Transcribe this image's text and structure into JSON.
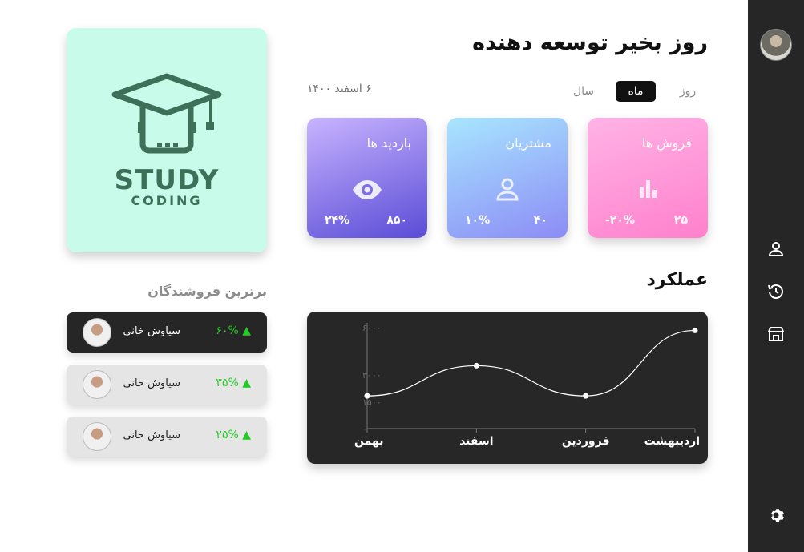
{
  "header": {
    "title": "روز بخیر توسعه دهنده"
  },
  "periods": [
    {
      "label": "روز",
      "active": false
    },
    {
      "label": "ماه",
      "active": true
    },
    {
      "label": "سال",
      "active": false
    }
  ],
  "date": "۶ اسفند ۱۴۰۰",
  "stats": [
    {
      "title": "فروش ها",
      "count": "۲۵",
      "change": "-۲۰%",
      "icon": "bar-chart-icon"
    },
    {
      "title": "مشتریان",
      "count": "۴۰",
      "change": "۱۰%",
      "icon": "user-icon"
    },
    {
      "title": "بازدید ها",
      "count": "۸۵۰",
      "change": "۲۴%",
      "icon": "eye-icon"
    }
  ],
  "performance": {
    "title": "عملکرد"
  },
  "chart_data": {
    "type": "line",
    "categories": [
      "بهمن",
      "اسفند",
      "فروردین",
      "اردیبهشت"
    ],
    "values": [
      1300,
      2500,
      1300,
      3900
    ],
    "y_ticks": [
      "۰",
      "۱۵۰۰",
      "۳۰۰۰",
      "۶۰۰۰"
    ],
    "ylim": [
      0,
      4200
    ],
    "grid": false,
    "colors": {
      "line": "#ffffff",
      "axis": "#7a7a7a"
    }
  },
  "logo": {
    "line1": "STUDY",
    "line2": "CODING",
    "icon": "graduation-cap-icon"
  },
  "sellers": {
    "title": "برترین فروشندگان",
    "items": [
      {
        "name": "سیاوش خانی",
        "percent": "۶۰%",
        "arrow": "▲"
      },
      {
        "name": "سیاوش خانی",
        "percent": "۳۵%",
        "arrow": "▲"
      },
      {
        "name": "سیاوش خانی",
        "percent": "۲۵%",
        "arrow": "▲"
      }
    ]
  },
  "sidebar": {
    "icons": [
      "user-icon",
      "history-icon",
      "store-icon",
      "gear-icon"
    ]
  }
}
